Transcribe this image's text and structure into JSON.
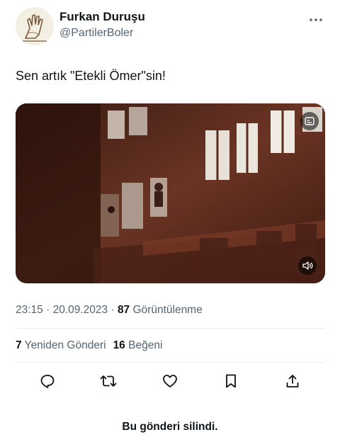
{
  "author": {
    "display_name": "Furkan Duruşu",
    "handle": "@PartilerBoler",
    "avatar_icon": "raised-fist-icon"
  },
  "tweet": {
    "text": "Sen artık \"Etekli Ömer\"sin!",
    "media": {
      "type": "video",
      "badge_icon": "caption-icon",
      "volume_icon": "speaker-icon"
    }
  },
  "meta": {
    "time": "23:15",
    "separator": " · ",
    "date": "20.09.2023",
    "separator2": " · ",
    "views_count": "87",
    "views_label": " Görüntülenme"
  },
  "stats": {
    "retweets_count": "7",
    "retweets_label": " Yeniden Gönderi",
    "likes_count": "16",
    "likes_label": " Beğeni"
  },
  "actions": [
    {
      "icon": "reply-icon"
    },
    {
      "icon": "retweet-icon"
    },
    {
      "icon": "like-icon"
    },
    {
      "icon": "bookmark-icon"
    },
    {
      "icon": "share-icon"
    }
  ],
  "footer": {
    "deleted_notice": "Bu gönderi silindi."
  },
  "colors": {
    "text_primary": "#0f1419",
    "text_secondary": "#536471",
    "divider": "#e6ecf0"
  }
}
